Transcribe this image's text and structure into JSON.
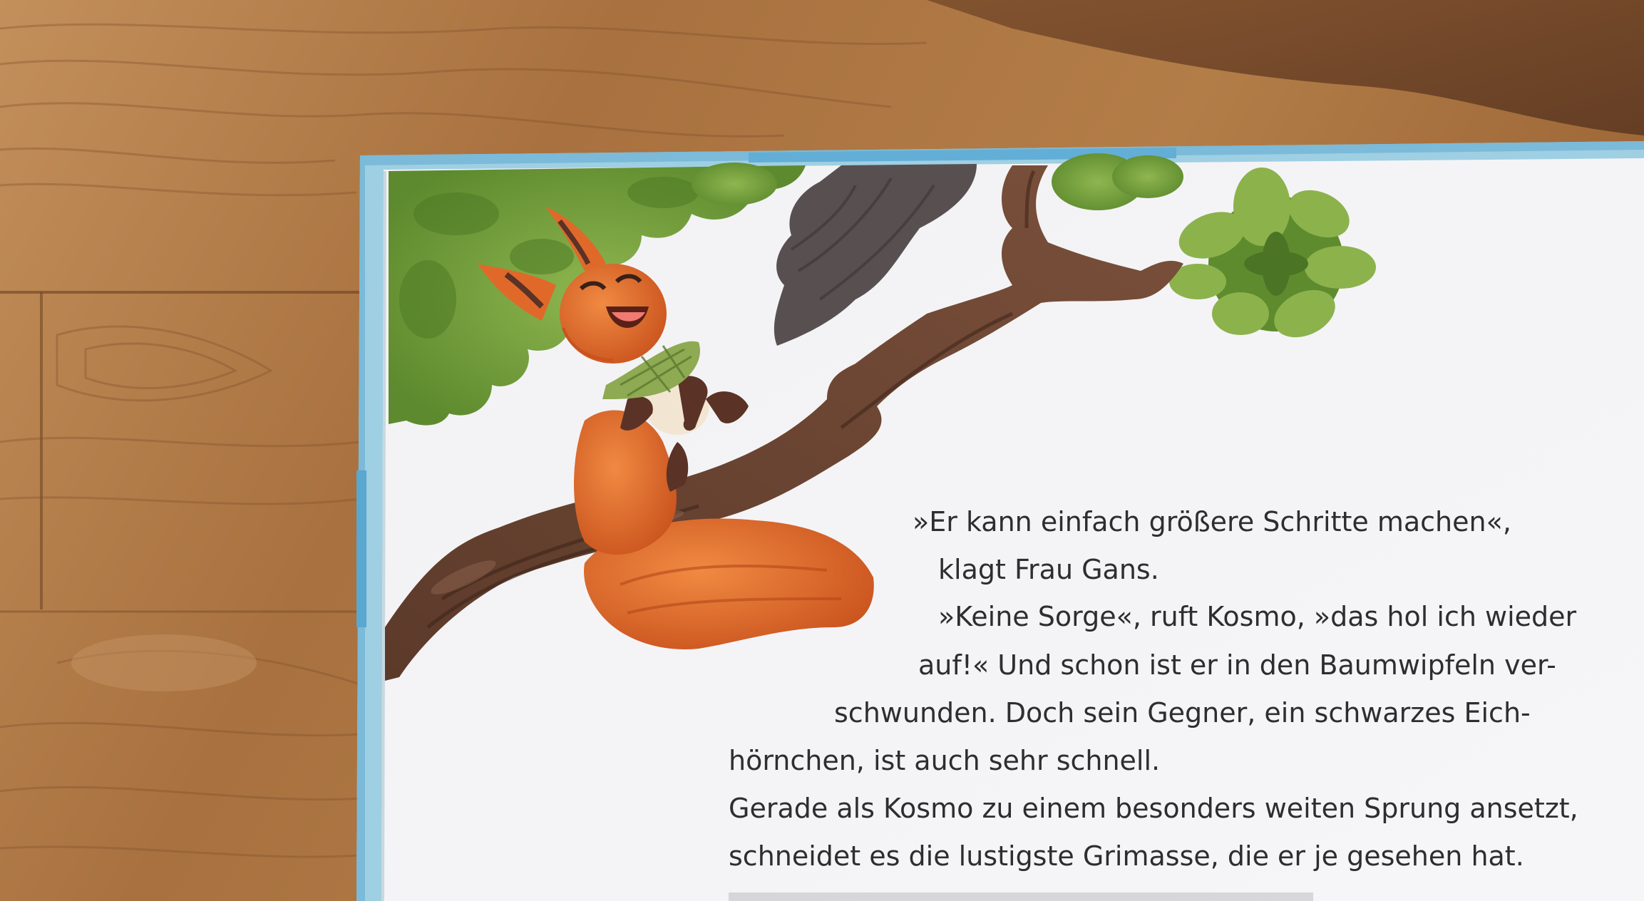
{
  "photo": {
    "subject": "children's book page lying on a wooden floor",
    "illustration": [
      "red squirrel laughing on a tree branch",
      "dark grey squirrel tail",
      "green leaves",
      "brown branch"
    ],
    "colors": {
      "wood_light": "#b07a45",
      "wood_dark": "#6e4324",
      "page": "#f4f4f6",
      "cover_edge": "#8cc6e2",
      "squirrel": "#e0692a",
      "leaves": "#6f9a3a",
      "branch": "#6b4431",
      "text": "#2f2d2d"
    }
  },
  "book_text": {
    "lines": [
      "»Er kann einfach größere Schritte machen«,",
      "klagt Frau Gans.",
      "»Keine Sorge«, ruft Kosmo, »das hol ich wieder",
      "auf!« Und schon ist er in den Baumwipfeln ver-",
      "schwunden. Doch sein Gegner, ein schwarzes Eich-",
      "hörnchen, ist auch sehr schnell.",
      "Gerade als Kosmo zu einem besonders weiten Sprung ansetzt,",
      "schneidet es die lustigste Grimasse, die er je gesehen hat."
    ]
  }
}
